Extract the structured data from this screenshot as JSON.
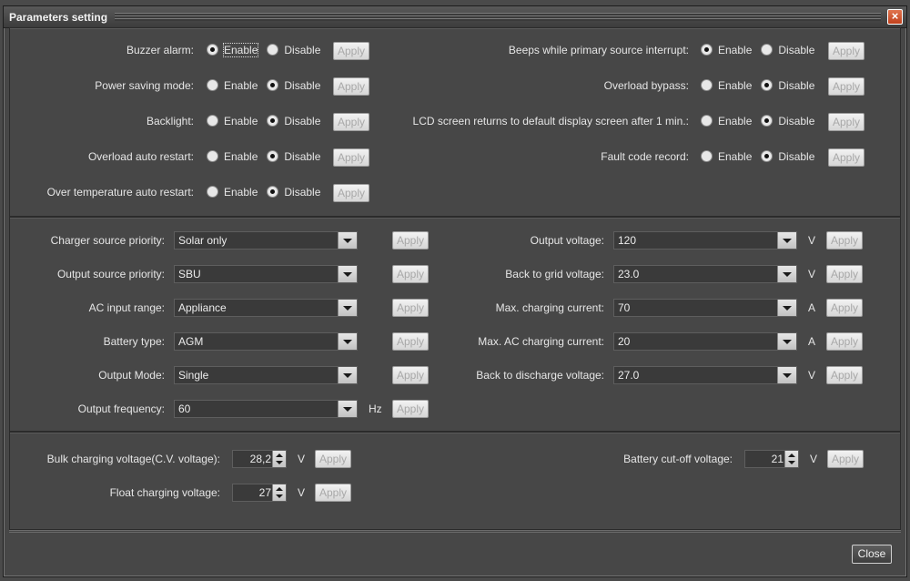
{
  "window": {
    "title": "Parameters setting"
  },
  "apply_label": "Apply",
  "enable_label": "Enable",
  "disable_label": "Disable",
  "toggles_left": [
    {
      "label": "Buzzer alarm:",
      "selected": "enable"
    },
    {
      "label": "Power saving mode:",
      "selected": "disable"
    },
    {
      "label": "Backlight:",
      "selected": "disable"
    },
    {
      "label": "Overload auto restart:",
      "selected": "disable"
    },
    {
      "label": "Over temperature auto restart:",
      "selected": "disable"
    }
  ],
  "toggles_right": [
    {
      "label": "Beeps while primary source interrupt:",
      "selected": "enable"
    },
    {
      "label": "Overload bypass:",
      "selected": "disable"
    },
    {
      "label": "LCD screen returns to default display screen after 1 min.:",
      "selected": "disable"
    },
    {
      "label": "Fault code record:",
      "selected": "disable"
    }
  ],
  "selects_left": [
    {
      "label": "Charger source priority:",
      "value": "Solar only",
      "unit": ""
    },
    {
      "label": "Output source priority:",
      "value": "SBU",
      "unit": ""
    },
    {
      "label": "AC input range:",
      "value": "Appliance",
      "unit": ""
    },
    {
      "label": "Battery type:",
      "value": "AGM",
      "unit": ""
    },
    {
      "label": "Output Mode:",
      "value": "Single",
      "unit": ""
    },
    {
      "label": "Output frequency:",
      "value": "60",
      "unit": "Hz"
    }
  ],
  "selects_right": [
    {
      "label": "Output voltage:",
      "value": "120",
      "unit": "V"
    },
    {
      "label": "Back to grid voltage:",
      "value": "23.0",
      "unit": "V"
    },
    {
      "label": "Max. charging current:",
      "value": "70",
      "unit": "A"
    },
    {
      "label": "Max. AC charging current:",
      "value": "20",
      "unit": "A"
    },
    {
      "label": "Back to discharge voltage:",
      "value": "27.0",
      "unit": "V"
    }
  ],
  "spinners": {
    "bulk": {
      "label": "Bulk charging voltage(C.V. voltage):",
      "value": "28,2",
      "unit": "V"
    },
    "float": {
      "label": "Float charging voltage:",
      "value": "27",
      "unit": "V"
    },
    "cutoff": {
      "label": "Battery cut-off voltage:",
      "value": "21",
      "unit": "V"
    }
  },
  "footer": {
    "close_label": "Close"
  },
  "colors": {
    "background": "#474747",
    "title_close": "#c0401c"
  }
}
